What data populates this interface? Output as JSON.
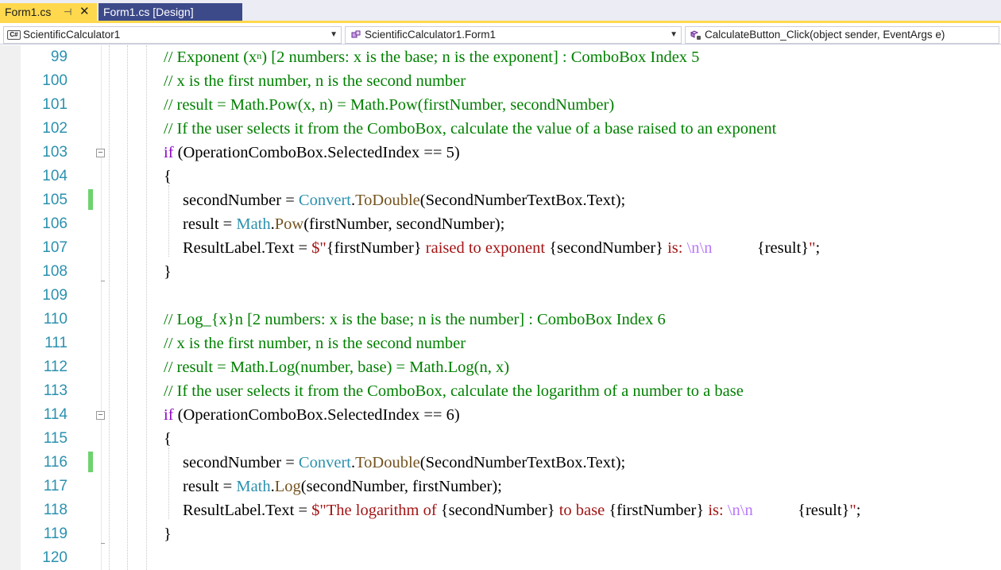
{
  "tabs": [
    {
      "label": "Form1.cs",
      "active": true,
      "pin_icon": "pin-icon",
      "close_icon": "close-icon"
    },
    {
      "label": "Form1.cs [Design]",
      "active": false
    }
  ],
  "navigation": {
    "project": {
      "label": "ScientificCalculator1",
      "icon": "csharp-project-icon",
      "badge": "C#"
    },
    "class": {
      "label": "ScientificCalculator1.Form1",
      "icon": "class-icon"
    },
    "member": {
      "label": "CalculateButton_Click(object sender, EventArgs e)",
      "icon": "method-icon"
    }
  },
  "colors": {
    "accent_tab": "#ffd84d",
    "inactive_tab": "#3d4a8a",
    "line_numbers": "#2b91af",
    "comment": "#008000",
    "keyword": "#8f08c4",
    "type": "#2b91af",
    "string": "#a31515",
    "change_marker": "#6ed26e"
  },
  "editor": {
    "line_numbers": [
      "99",
      "100",
      "101",
      "102",
      "103",
      "104",
      "105",
      "106",
      "107",
      "108",
      "109",
      "110",
      "111",
      "112",
      "113",
      "114",
      "115",
      "116",
      "117",
      "118",
      "119",
      "120"
    ],
    "lines": {
      "l99_pre": "// Exponent (x",
      "l99_sup": "n",
      "l99_post": ") [2 numbers: x is the base; n is the exponent] : ComboBox Index 5",
      "l100": "// x is the first number, n is the second number",
      "l101": "// result = Math.Pow(x, n) = Math.Pow(firstNumber, secondNumber)",
      "l102": "// If the user selects it from the ComboBox, calculate the value of a base raised to an exponent",
      "l103_kw": "if",
      "l103_rest": " (OperationComboBox.SelectedIndex == 5)",
      "l104": "{",
      "l105_a": "secondNumber = ",
      "l105_type": "Convert",
      "l105_dot": ".",
      "l105_method": "ToDouble",
      "l105_b": "(SecondNumberTextBox.Text);",
      "l106_a": "result = ",
      "l106_type": "Math",
      "l106_dot": ".",
      "l106_method": "Pow",
      "l106_b": "(firstNumber, secondNumber);",
      "l107_a": "ResultLabel.Text = ",
      "l107_s1": "$\"",
      "l107_i1": "{firstNumber}",
      "l107_s2": " raised to exponent ",
      "l107_i2": "{secondNumber}",
      "l107_s3": " is: ",
      "l107_esc": "\\n\\n",
      "l107_s4": "           ",
      "l107_i3": "{result}",
      "l107_s5": "\"",
      "l107_end": ";",
      "l108": "}",
      "l110": "// Log_{x}n [2 numbers: x is the base; n is the number] : ComboBox Index 6",
      "l111": "// x is the first number, n is the second number",
      "l112": "// result = Math.Log(number, base) = Math.Log(n, x)",
      "l113": "// If the user selects it from the ComboBox, calculate the logarithm of a number to a base",
      "l114_kw": "if",
      "l114_rest": " (OperationComboBox.SelectedIndex == 6)",
      "l115": "{",
      "l116_a": "secondNumber = ",
      "l116_type": "Convert",
      "l116_dot": ".",
      "l116_method": "ToDouble",
      "l116_b": "(SecondNumberTextBox.Text);",
      "l117_a": "result = ",
      "l117_type": "Math",
      "l117_dot": ".",
      "l117_method": "Log",
      "l117_b": "(secondNumber, firstNumber);",
      "l118_a": "ResultLabel.Text = ",
      "l118_s1": "$\"The logarithm of ",
      "l118_i1": "{secondNumber}",
      "l118_s2": " to base ",
      "l118_i2": "{firstNumber}",
      "l118_s3": " is: ",
      "l118_esc": "\\n\\n",
      "l118_s4": "           ",
      "l118_i3": "{result}",
      "l118_s5": "\"",
      "l118_end": ";",
      "l119": "}"
    }
  }
}
